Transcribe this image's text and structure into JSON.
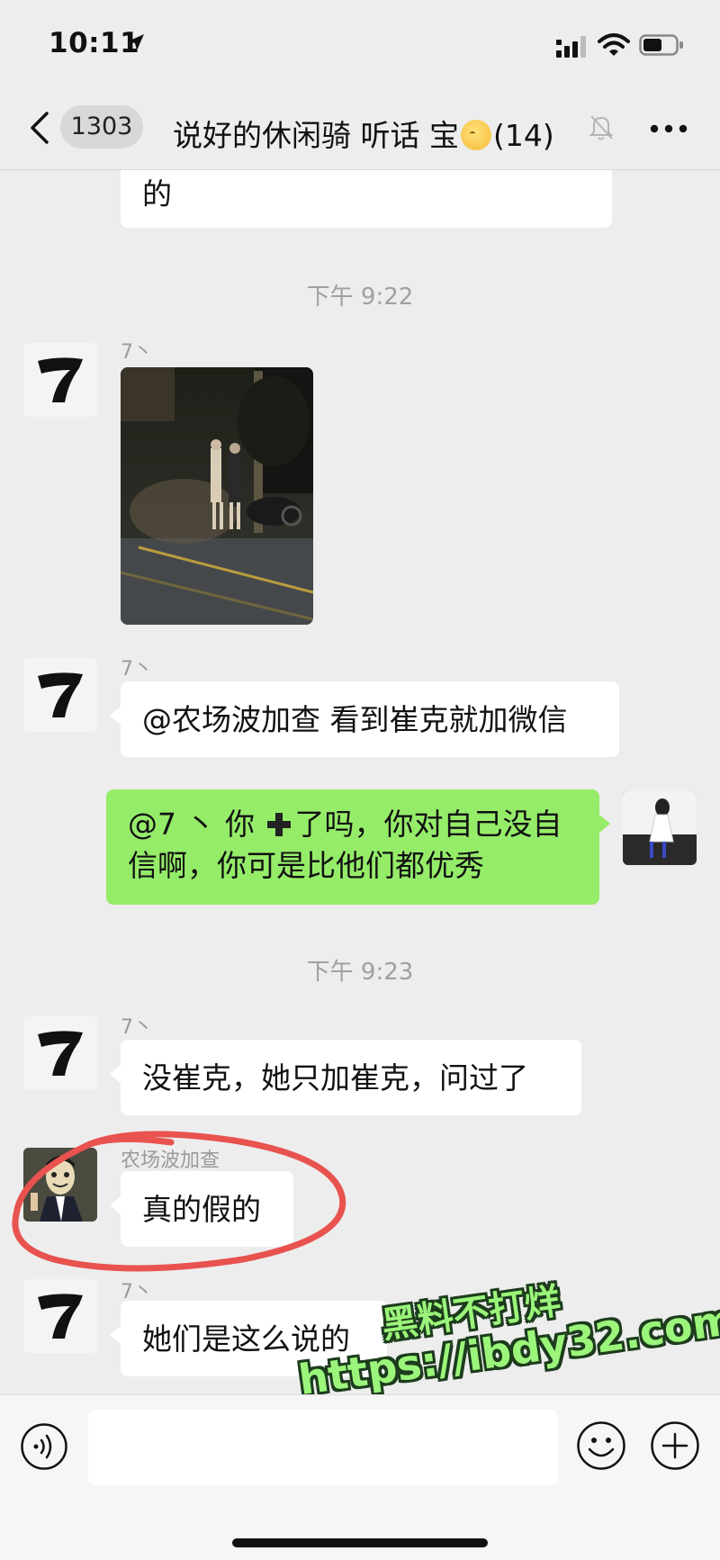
{
  "status_bar": {
    "time": "10:11",
    "icons": [
      "location-arrow-icon",
      "cellular-signal-icon",
      "wifi-icon",
      "battery-icon"
    ]
  },
  "nav": {
    "back_icon": "chevron-left-icon",
    "unread_count": "1303",
    "title_text": "说好的休闲骑  听话  宝",
    "title_emoji": "kissing-face-emoji",
    "member_count": "(14)",
    "mute_icon": "muted-bell-icon",
    "more_icon": "more-dots-icon"
  },
  "messages": [
    {
      "type": "text",
      "side": "left",
      "text": "的"
    },
    {
      "type": "time",
      "text": "下午 9:22"
    },
    {
      "type": "image",
      "side": "left",
      "sender": "7丶"
    },
    {
      "type": "text",
      "side": "left",
      "sender": "7丶",
      "text": "@农场波加查 看到崔克就加微信"
    },
    {
      "type": "text",
      "side": "right",
      "line1_before": "@7 丶 你",
      "line1_after": "了吗，你对自己没自",
      "line2": "信啊，你可是比他们都优秀",
      "inline_emoji": "heavy-plus-emoji"
    },
    {
      "type": "time",
      "text": "下午 9:23"
    },
    {
      "type": "text",
      "side": "left",
      "sender": "7丶",
      "text": "没崔克，她只加崔克，问过了"
    },
    {
      "type": "text",
      "side": "left",
      "sender": "农场波加查",
      "text": "真的假的"
    },
    {
      "type": "text",
      "side": "left",
      "sender": "7丶",
      "text": "她们是这么说的"
    }
  ],
  "watermark": {
    "line1": "黑料不打烊",
    "line2": "https://ibdy32.com"
  },
  "annotation": {
    "color": "#e8524f"
  },
  "input_bar": {
    "placeholder": "",
    "icons": [
      "voice-icon",
      "emoji-icon",
      "plus-icon"
    ]
  },
  "colors": {
    "background": "#ededed",
    "my_bubble": "#95ec69",
    "their_bubble": "#ffffff"
  }
}
